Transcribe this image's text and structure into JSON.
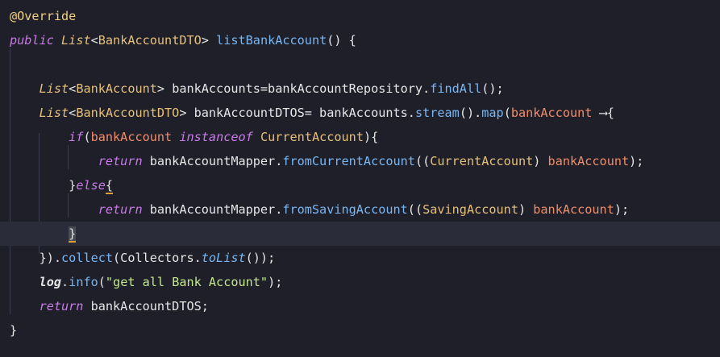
{
  "editor": {
    "lines": [
      {
        "segments": [
          {
            "t": "@Override",
            "c": "ann"
          }
        ]
      },
      {
        "segments": [
          {
            "t": "public",
            "c": "kw"
          },
          {
            "t": " ",
            "c": "pl"
          },
          {
            "t": "List",
            "c": "typei"
          },
          {
            "t": "<",
            "c": "pl"
          },
          {
            "t": "BankAccountDTO",
            "c": "type"
          },
          {
            "t": "> ",
            "c": "pl"
          },
          {
            "t": "listBankAccount",
            "c": "fn"
          },
          {
            "t": "() {",
            "c": "pl"
          }
        ]
      },
      {
        "segments": []
      },
      {
        "segments": [
          {
            "t": "    ",
            "c": "pl"
          },
          {
            "t": "List",
            "c": "typei"
          },
          {
            "t": "<",
            "c": "pl"
          },
          {
            "t": "BankAccount",
            "c": "type"
          },
          {
            "t": "> bankAccounts=bankAccountRepository.",
            "c": "pl"
          },
          {
            "t": "findAll",
            "c": "fn"
          },
          {
            "t": "();",
            "c": "pl"
          }
        ]
      },
      {
        "segments": [
          {
            "t": "    ",
            "c": "pl"
          },
          {
            "t": "List",
            "c": "typei"
          },
          {
            "t": "<",
            "c": "pl"
          },
          {
            "t": "BankAccountDTO",
            "c": "type"
          },
          {
            "t": "> bankAccountDTOS= bankAccounts.",
            "c": "pl"
          },
          {
            "t": "stream",
            "c": "fn"
          },
          {
            "t": "().",
            "c": "pl"
          },
          {
            "t": "map",
            "c": "fn"
          },
          {
            "t": "(",
            "c": "pl"
          },
          {
            "t": "bankAccount",
            "c": "param"
          },
          {
            "t": " ⟶{",
            "c": "pl"
          }
        ]
      },
      {
        "segments": [
          {
            "t": "        ",
            "c": "pl"
          },
          {
            "t": "if",
            "c": "kw"
          },
          {
            "t": "(",
            "c": "pl"
          },
          {
            "t": "bankAccount",
            "c": "param"
          },
          {
            "t": " ",
            "c": "pl"
          },
          {
            "t": "instanceof",
            "c": "kw"
          },
          {
            "t": " ",
            "c": "pl"
          },
          {
            "t": "CurrentAccount",
            "c": "type"
          },
          {
            "t": "){",
            "c": "pl"
          }
        ]
      },
      {
        "segments": [
          {
            "t": "            ",
            "c": "pl"
          },
          {
            "t": "return",
            "c": "kw"
          },
          {
            "t": " bankAccountMapper.",
            "c": "pl"
          },
          {
            "t": "fromCurrentAccount",
            "c": "fn"
          },
          {
            "t": "((",
            "c": "pl"
          },
          {
            "t": "CurrentAccount",
            "c": "type"
          },
          {
            "t": ") ",
            "c": "pl"
          },
          {
            "t": "bankAccount",
            "c": "param"
          },
          {
            "t": ");",
            "c": "pl"
          }
        ]
      },
      {
        "segments": [
          {
            "t": "        ",
            "c": "pl"
          },
          {
            "t": "}",
            "c": "pl"
          },
          {
            "t": "else",
            "c": "kw"
          },
          {
            "t": "{",
            "c": "brace-match"
          }
        ]
      },
      {
        "segments": [
          {
            "t": "            ",
            "c": "pl"
          },
          {
            "t": "return",
            "c": "kw"
          },
          {
            "t": " bankAccountMapper.",
            "c": "pl"
          },
          {
            "t": "fromSavingAccount",
            "c": "fn"
          },
          {
            "t": "((",
            "c": "pl"
          },
          {
            "t": "SavingAccount",
            "c": "type"
          },
          {
            "t": ") ",
            "c": "pl"
          },
          {
            "t": "bankAccount",
            "c": "param"
          },
          {
            "t": ");",
            "c": "pl"
          }
        ]
      },
      {
        "segments": [
          {
            "t": "        ",
            "c": "pl"
          },
          {
            "t": "}",
            "c": "caret-brace"
          }
        ]
      },
      {
        "segments": [
          {
            "t": "    }).",
            "c": "pl"
          },
          {
            "t": "collect",
            "c": "fn"
          },
          {
            "t": "(Collectors.",
            "c": "pl"
          },
          {
            "t": "toList",
            "c": "fni"
          },
          {
            "t": "());",
            "c": "pl"
          }
        ]
      },
      {
        "segments": [
          {
            "t": "    ",
            "c": "pl"
          },
          {
            "t": "log",
            "c": "bold"
          },
          {
            "t": ".",
            "c": "pl"
          },
          {
            "t": "info",
            "c": "fn"
          },
          {
            "t": "(",
            "c": "pl"
          },
          {
            "t": "\"get all Bank Account\"",
            "c": "str"
          },
          {
            "t": ");",
            "c": "pl"
          }
        ]
      },
      {
        "segments": [
          {
            "t": "    ",
            "c": "pl"
          },
          {
            "t": "return",
            "c": "kw"
          },
          {
            "t": " bankAccountDTOS;",
            "c": "pl"
          }
        ]
      },
      {
        "segments": [
          {
            "t": "}",
            "c": "pl"
          }
        ]
      }
    ],
    "current_line": 9
  }
}
